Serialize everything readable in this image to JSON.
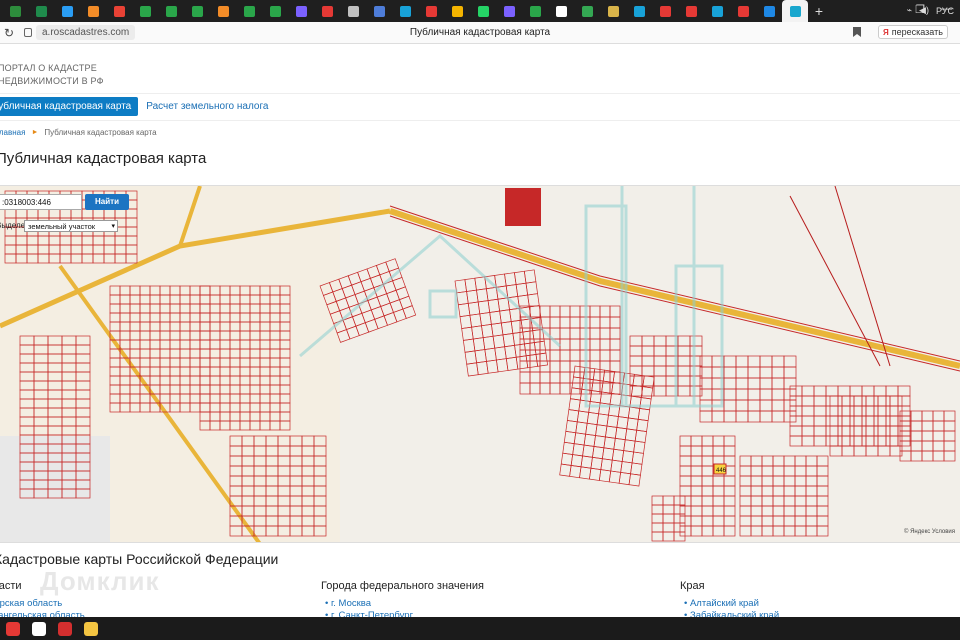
{
  "browser": {
    "url": "a.roscadastres.com",
    "title": "Публичная кадастровая карта",
    "translate_label": "пересказать",
    "tab_icons": [
      "#2d8c3c",
      "#1f8b4c",
      "#2a9df4",
      "#f28c28",
      "#e94235",
      "#2aa64a",
      "#2aa64a",
      "#2aa64a",
      "#f28c28",
      "#2aa64a",
      "#2aa64a",
      "#7b61ff",
      "#e53935",
      "#c0c0c0",
      "#4e7dd9",
      "#18a2d8",
      "#e53935",
      "#f4b400",
      "#25d366",
      "#7b61ff",
      "#2aa64a",
      "#ffffff",
      "#34a853",
      "#d9b44a",
      "#18a2d8",
      "#e53935",
      "#e53935",
      "#18a2d8",
      "#e53935",
      "#1e88e5"
    ],
    "active_tab_icon": "#19a7ce"
  },
  "portal": {
    "logo_line1": "ПОРТАЛ О КАДАСТРЕ",
    "logo_line2": "НЕДВИЖИМОСТИ В РФ",
    "nav_active": "Публичная кадастровая карта",
    "nav_link": "Расчет земельного налога",
    "breadcrumb_home": "Главная",
    "breadcrumb_current": "Публичная кадастровая карта",
    "heading": "Публичная кадастровая карта"
  },
  "map": {
    "search_value": ":0318003:446",
    "search_button": "Найти",
    "select_label": "Выделение",
    "select_value": "земельный участок",
    "copyright": "© Яндекс  Условия",
    "highlight_label": "446"
  },
  "bottom": {
    "heading": "Кадастровые карты Российской Федерации",
    "watermark": "Домклик",
    "col1_heading": "Области",
    "col1_items": [
      "Амурская область",
      "Архангельская область"
    ],
    "col2_heading": "Города федерального значения",
    "col2_items": [
      "г. Москва",
      "г. Санкт-Петербург"
    ],
    "col3_heading": "Края",
    "col3_items": [
      "Алтайский край",
      "Забайкальский край"
    ]
  },
  "taskbar": {
    "icons": [
      "#e53935",
      "#ffffff",
      "#d32f2f",
      "#f4c542"
    ],
    "tray": "РУС"
  }
}
